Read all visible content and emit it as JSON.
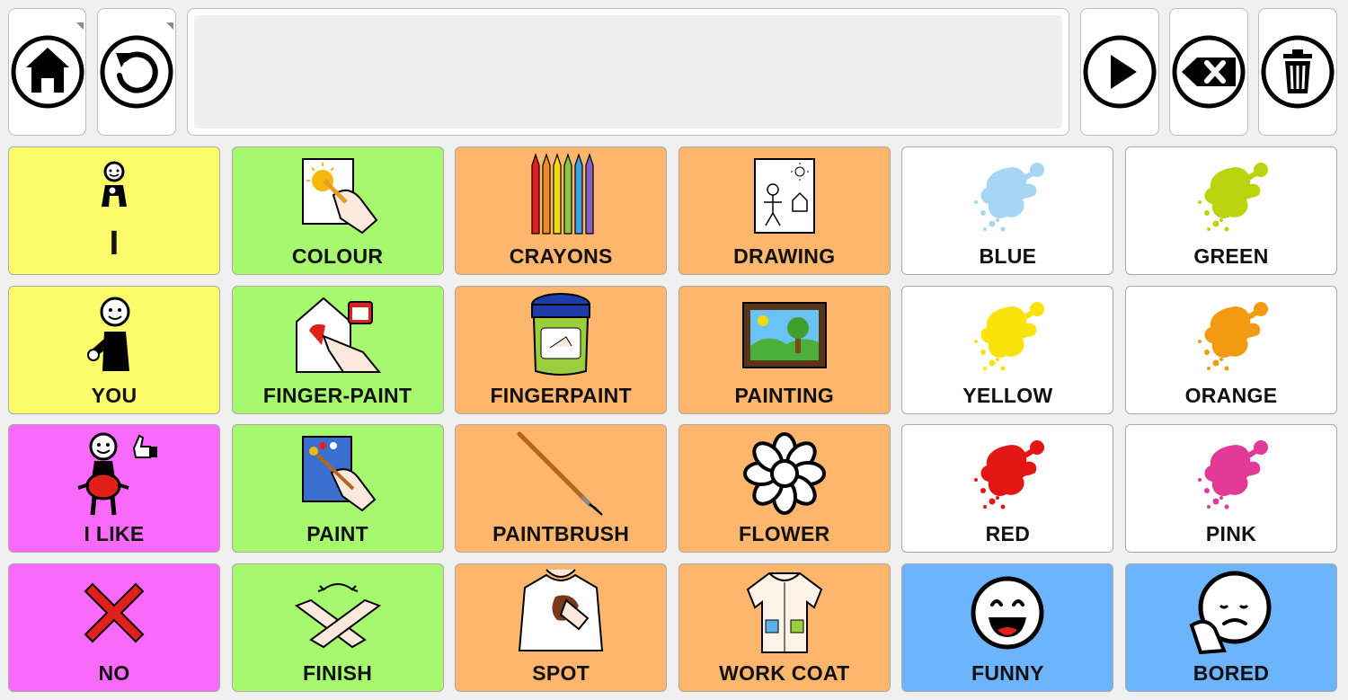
{
  "toolbar": {
    "message": "",
    "buttons": [
      {
        "name": "home-icon"
      },
      {
        "name": "back-icon"
      },
      {
        "name": "speak-icon"
      },
      {
        "name": "backspace-icon"
      },
      {
        "name": "clear-icon"
      }
    ]
  },
  "colors": {
    "yellow": "#fcfc6b",
    "green": "#a6f86e",
    "orange": "#fdb66b",
    "white": "#ffffff",
    "magenta": "#fa6afa",
    "blue": "#6cb4fc"
  },
  "grid": {
    "cells": [
      {
        "label": "I",
        "bg": "#fcfc6b",
        "icon": "person-pointing-self-icon"
      },
      {
        "label": "COLOUR",
        "bg": "#a6f86e",
        "icon": "hand-colouring-icon"
      },
      {
        "label": "CRAYONS",
        "bg": "#fdb66b",
        "icon": "crayons-icon"
      },
      {
        "label": "DRAWING",
        "bg": "#fdb66b",
        "icon": "stick-drawing-icon"
      },
      {
        "label": "BLUE",
        "bg": "#ffffff",
        "icon": "paint-splat-icon",
        "splat": "#a6d6f3"
      },
      {
        "label": "GREEN",
        "bg": "#ffffff",
        "icon": "paint-splat-icon",
        "splat": "#bcd40d"
      },
      {
        "label": "YOU",
        "bg": "#fcfc6b",
        "icon": "person-pointing-you-icon"
      },
      {
        "label": "FINGER-PAINT",
        "bg": "#a6f86e",
        "icon": "finger-paint-hand-icon"
      },
      {
        "label": "FINGERPAINT",
        "bg": "#fdb66b",
        "icon": "paint-jar-icon"
      },
      {
        "label": "PAINTING",
        "bg": "#fdb66b",
        "icon": "framed-painting-icon"
      },
      {
        "label": "YELLOW",
        "bg": "#ffffff",
        "icon": "paint-splat-icon",
        "splat": "#fce20b"
      },
      {
        "label": "ORANGE",
        "bg": "#ffffff",
        "icon": "paint-splat-icon",
        "splat": "#f39a10"
      },
      {
        "label": "I LIKE",
        "bg": "#fa6afa",
        "icon": "person-like-icon"
      },
      {
        "label": "PAINT",
        "bg": "#a6f86e",
        "icon": "hand-painting-icon"
      },
      {
        "label": "PAINTBRUSH",
        "bg": "#fdb66b",
        "icon": "paintbrush-icon"
      },
      {
        "label": "FLOWER",
        "bg": "#fdb66b",
        "icon": "flower-icon"
      },
      {
        "label": "RED",
        "bg": "#ffffff",
        "icon": "paint-splat-icon",
        "splat": "#e31515"
      },
      {
        "label": "PINK",
        "bg": "#ffffff",
        "icon": "paint-splat-icon",
        "splat": "#e23a96"
      },
      {
        "label": "NO",
        "bg": "#fa6afa",
        "icon": "red-cross-icon"
      },
      {
        "label": "FINISH",
        "bg": "#a6f86e",
        "icon": "crossed-arms-icon"
      },
      {
        "label": "SPOT",
        "bg": "#fdb66b",
        "icon": "stained-shirt-icon"
      },
      {
        "label": "WORK COAT",
        "bg": "#fdb66b",
        "icon": "smock-icon"
      },
      {
        "label": "FUNNY",
        "bg": "#6cb4fc",
        "icon": "laughing-face-icon"
      },
      {
        "label": "BORED",
        "bg": "#6cb4fc",
        "icon": "bored-face-icon"
      }
    ]
  }
}
